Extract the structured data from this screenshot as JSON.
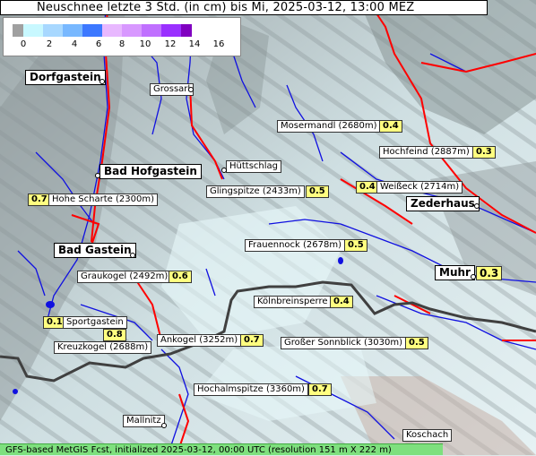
{
  "title": "Neuschnee letzte 3 Std. (in cm) bis Mi, 2025-03-12, 13:00 MEZ",
  "legend": {
    "ticks": [
      "0",
      "2",
      "4",
      "6",
      "8",
      "10",
      "12",
      "14",
      "16"
    ],
    "colors": [
      "#a0a0a0",
      "#c8f8ff",
      "#a8d8ff",
      "#78b8ff",
      "#3c78ff",
      "#e8b8ff",
      "#d898ff",
      "#c070ff",
      "#9a30ff",
      "#8000c0"
    ]
  },
  "towns": [
    {
      "name": "Dorfgastein"
    },
    {
      "name": "Bad Hofgastein"
    },
    {
      "name": "Bad Gastein"
    },
    {
      "name": "Zederhaus"
    },
    {
      "name": "Muhr",
      "value": "0.3"
    }
  ],
  "places": [
    {
      "name": "Grossarl"
    },
    {
      "name": "Mosermandl (2680m)",
      "value": "0.4"
    },
    {
      "name": "Hochfeind (2887m)",
      "value": "0.3"
    },
    {
      "name": "Hüttschlag"
    },
    {
      "name": "Glingspitze (2433m)",
      "value": "0.5"
    },
    {
      "name": "Weißeck (2714m)",
      "value": "0.4"
    },
    {
      "name": "Hohe Scharte (2300m)",
      "value": "0.7"
    },
    {
      "name": "Frauennock (2678m)",
      "value": "0.5"
    },
    {
      "name": "Graukogel (2492m)",
      "value": "0.6"
    },
    {
      "name": "Kölnbreinsperre",
      "value": "0.4"
    },
    {
      "name": "Sportgastein",
      "value": "0.1"
    },
    {
      "name": "Kreuzkogel (2688m)",
      "value": "0.8"
    },
    {
      "name": "Ankogel (3252m)",
      "value": "0.7"
    },
    {
      "name": "Großer Sonnblick (3030m)",
      "value": "0.5"
    },
    {
      "name": "Hochalmspitze (3360m)",
      "value": "0.7"
    },
    {
      "name": "Mallnitz"
    },
    {
      "name": "Koschach"
    }
  ],
  "footer": "GFS-based MetGIS Fcst, initialized 2025-03-12, 00:00 UTC  (resolution 151 m X 222 m)",
  "colors": {
    "river": "#1010e0",
    "road": "#ff0000",
    "border": "#404040",
    "snow": "#dff0f2",
    "footer": "#7ee07e",
    "value_box": "#ffff80"
  }
}
